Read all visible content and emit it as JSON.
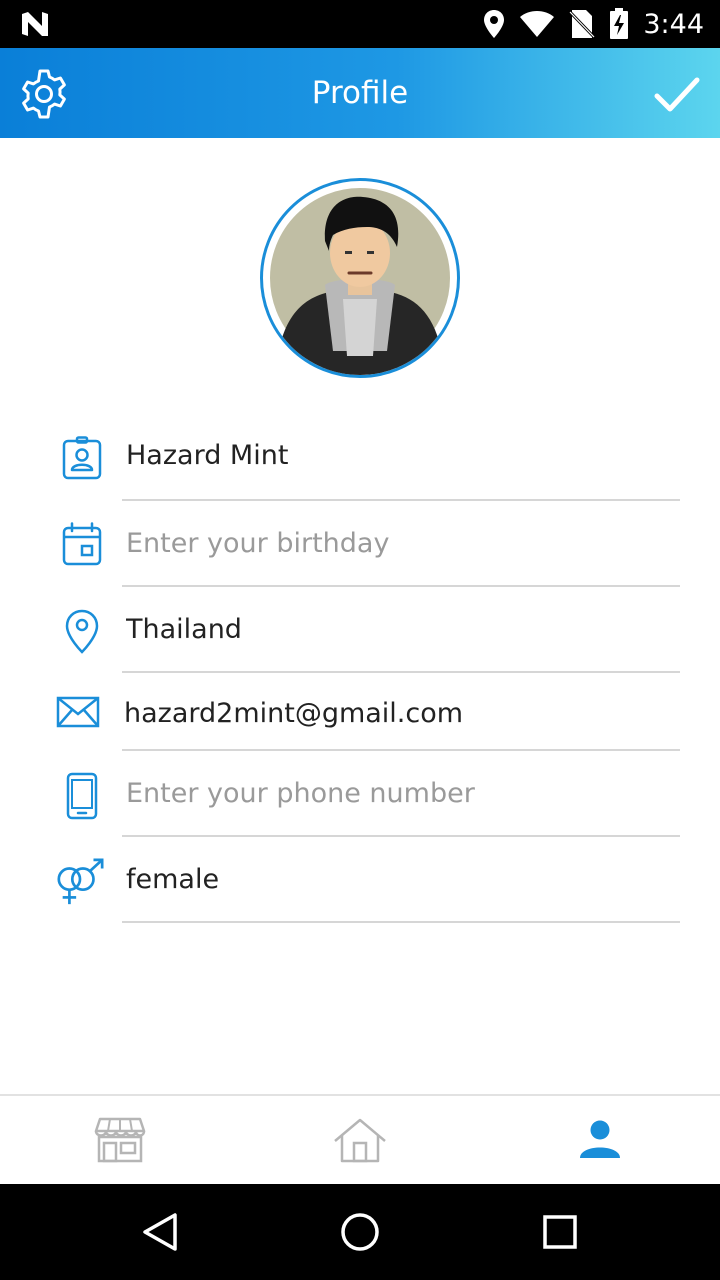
{
  "status_bar": {
    "time": "3:44"
  },
  "app_bar": {
    "title": "Profile"
  },
  "profile": {
    "fields": [
      {
        "name": "name",
        "value": "Hazard Mint",
        "placeholder": "",
        "icon": "id-badge-icon"
      },
      {
        "name": "birthday",
        "value": "",
        "placeholder": "Enter your birthday",
        "icon": "calendar-icon"
      },
      {
        "name": "location",
        "value": "Thailand",
        "placeholder": "",
        "icon": "location-pin-icon"
      },
      {
        "name": "email",
        "value": "hazard2mint@gmail.com",
        "placeholder": "",
        "icon": "envelope-icon"
      },
      {
        "name": "phone",
        "value": "",
        "placeholder": "Enter your phone number",
        "icon": "phone-icon"
      },
      {
        "name": "gender",
        "value": "female",
        "placeholder": "",
        "icon": "gender-icon"
      }
    ]
  },
  "bottom_nav": {
    "tabs": [
      {
        "name": "store",
        "icon": "store-icon",
        "active": false
      },
      {
        "name": "home",
        "icon": "home-icon",
        "active": false
      },
      {
        "name": "profile",
        "icon": "person-icon",
        "active": true
      }
    ]
  },
  "colors": {
    "accent": "#1a8ed9",
    "inactive": "#b5b5b5",
    "divider": "#d6d6d6"
  }
}
